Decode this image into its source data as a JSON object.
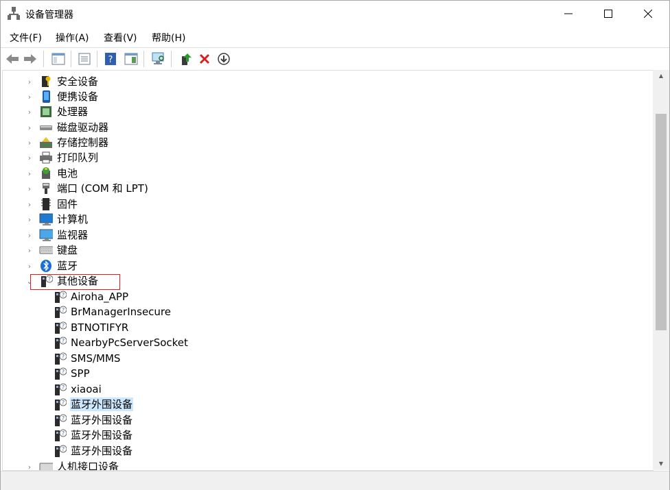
{
  "window": {
    "title": "设备管理器",
    "minimize": "—",
    "maximize": "☐",
    "close": "✕"
  },
  "menubar": [
    "文件(F)",
    "操作(A)",
    "查看(V)",
    "帮助(H)"
  ],
  "toolbar": {
    "buttons": [
      "back-icon",
      "forward-icon",
      "show-hide-tree-icon",
      "properties-icon",
      "help-icon",
      "action-pane-icon",
      "scan-hardware-icon",
      "update-driver-icon",
      "uninstall-icon",
      "download-icon"
    ]
  },
  "tree": {
    "categories": [
      {
        "label": "安全设备",
        "icon": "security-device-icon",
        "state": "collapsed"
      },
      {
        "label": "便携设备",
        "icon": "portable-device-icon",
        "state": "collapsed"
      },
      {
        "label": "处理器",
        "icon": "processor-icon",
        "state": "collapsed"
      },
      {
        "label": "磁盘驱动器",
        "icon": "disk-drive-icon",
        "state": "collapsed"
      },
      {
        "label": "存储控制器",
        "icon": "storage-controller-icon",
        "state": "collapsed"
      },
      {
        "label": "打印队列",
        "icon": "printer-icon",
        "state": "collapsed"
      },
      {
        "label": "电池",
        "icon": "battery-icon",
        "state": "collapsed"
      },
      {
        "label": "端口 (COM 和 LPT)",
        "icon": "port-icon",
        "state": "collapsed"
      },
      {
        "label": "固件",
        "icon": "firmware-icon",
        "state": "collapsed"
      },
      {
        "label": "计算机",
        "icon": "computer-icon",
        "state": "collapsed"
      },
      {
        "label": "监视器",
        "icon": "monitor-icon",
        "state": "collapsed"
      },
      {
        "label": "键盘",
        "icon": "keyboard-icon",
        "state": "collapsed"
      },
      {
        "label": "蓝牙",
        "icon": "bluetooth-icon",
        "state": "collapsed"
      },
      {
        "label": "其他设备",
        "icon": "unknown-device-icon",
        "state": "expanded"
      }
    ],
    "other_devices": [
      {
        "label": "Airoha_APP"
      },
      {
        "label": "BrManagerInsecure"
      },
      {
        "label": "BTNOTIFYR"
      },
      {
        "label": "NearbyPcServerSocket"
      },
      {
        "label": "SMS/MMS"
      },
      {
        "label": "SPP"
      },
      {
        "label": "xiaoai"
      },
      {
        "label": "蓝牙外围设备",
        "selected": true
      },
      {
        "label": "蓝牙外围设备"
      },
      {
        "label": "蓝牙外围设备"
      },
      {
        "label": "蓝牙外围设备"
      }
    ],
    "after": [
      {
        "label": "人机接口设备",
        "icon": "hid-icon",
        "state": "collapsed"
      }
    ]
  },
  "colors": {
    "selection": "#cce8ff",
    "highlight_border": "#d02020"
  }
}
